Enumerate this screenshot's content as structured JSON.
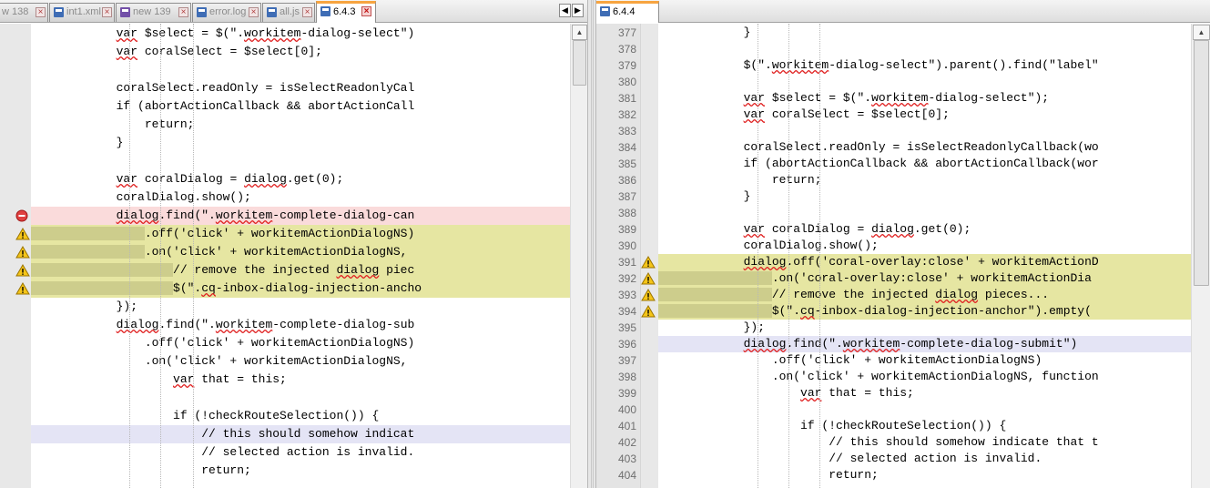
{
  "left": {
    "tabs": [
      {
        "label": "w 138",
        "icon": "blue"
      },
      {
        "label": "int1.xml",
        "icon": "blue"
      },
      {
        "label": "new 139",
        "icon": "purple"
      },
      {
        "label": "error.log",
        "icon": "blue"
      },
      {
        "label": "all.js",
        "icon": "blue"
      },
      {
        "label": "6.4.3",
        "icon": "blue"
      }
    ],
    "active_tab": "6.4.3",
    "lines": [
      {
        "text": "            var $select = $(\".workitem-dialog-select\")",
        "state": "normal"
      },
      {
        "text": "            var coralSelect = $select[0];",
        "state": "normal"
      },
      {
        "text": "",
        "state": "normal"
      },
      {
        "text": "            coralSelect.readOnly = isSelectReadonlyCal",
        "state": "normal"
      },
      {
        "text": "            if (abortActionCallback && abortActionCall",
        "state": "normal"
      },
      {
        "text": "                return;",
        "state": "normal"
      },
      {
        "text": "            }",
        "state": "normal"
      },
      {
        "text": "",
        "state": "normal"
      },
      {
        "text": "            var coralDialog = dialog.get(0);",
        "state": "normal"
      },
      {
        "text": "            coralDialog.show();",
        "state": "normal"
      },
      {
        "text": "            dialog.find(\".workitem-complete-dialog-can",
        "state": "removed"
      },
      {
        "text": "                .off('click' + workitemActionDialogNS)",
        "state": "changed"
      },
      {
        "text": "                .on('click' + workitemActionDialogNS,",
        "state": "changed"
      },
      {
        "text": "                    // remove the injected dialog piec",
        "state": "changed"
      },
      {
        "text": "                    $(\".cq-inbox-dialog-injection-ancho",
        "state": "changed"
      },
      {
        "text": "            });",
        "state": "normal"
      },
      {
        "text": "            dialog.find(\".workitem-complete-dialog-sub",
        "state": "normal"
      },
      {
        "text": "                .off('click' + workitemActionDialogNS)",
        "state": "normal"
      },
      {
        "text": "                .on('click' + workitemActionDialogNS,",
        "state": "normal"
      },
      {
        "text": "                    var that = this;",
        "state": "normal"
      },
      {
        "text": "",
        "state": "normal"
      },
      {
        "text": "                    if (!checkRouteSelection()) {",
        "state": "normal"
      },
      {
        "text": "                        // this should somehow indicat",
        "state": "moved"
      },
      {
        "text": "                        // selected action is invalid.",
        "state": "normal"
      },
      {
        "text": "                        return;",
        "state": "normal"
      }
    ]
  },
  "right": {
    "tabs": [
      {
        "label": "6.4.4",
        "icon": "blue"
      }
    ],
    "active_tab": "6.4.4",
    "lines": [
      {
        "num": "377",
        "text": "            }",
        "state": "normal"
      },
      {
        "num": "378",
        "text": "",
        "state": "normal"
      },
      {
        "num": "379",
        "text": "            $(\".workitem-dialog-select\").parent().find(\"label\"",
        "state": "normal"
      },
      {
        "num": "380",
        "text": "",
        "state": "normal"
      },
      {
        "num": "381",
        "text": "            var $select = $(\".workitem-dialog-select\");",
        "state": "normal"
      },
      {
        "num": "382",
        "text": "            var coralSelect = $select[0];",
        "state": "normal"
      },
      {
        "num": "383",
        "text": "",
        "state": "normal"
      },
      {
        "num": "384",
        "text": "            coralSelect.readOnly = isSelectReadonlyCallback(wo",
        "state": "normal"
      },
      {
        "num": "385",
        "text": "            if (abortActionCallback && abortActionCallback(wor",
        "state": "normal"
      },
      {
        "num": "386",
        "text": "                return;",
        "state": "normal"
      },
      {
        "num": "387",
        "text": "            }",
        "state": "normal"
      },
      {
        "num": "388",
        "text": "",
        "state": "normal"
      },
      {
        "num": "389",
        "text": "            var coralDialog = dialog.get(0);",
        "state": "normal"
      },
      {
        "num": "390",
        "text": "            coralDialog.show();",
        "state": "normal"
      },
      {
        "num": "391",
        "text": "            dialog.off('coral-overlay:close' + workitemActionD",
        "state": "changed"
      },
      {
        "num": "392",
        "text": "                .on('coral-overlay:close' + workitemActionDia",
        "state": "changed"
      },
      {
        "num": "393",
        "text": "                // remove the injected dialog pieces...",
        "state": "changed"
      },
      {
        "num": "394",
        "text": "                $(\".cq-inbox-dialog-injection-anchor\").empty(",
        "state": "changed"
      },
      {
        "num": "395",
        "text": "            });",
        "state": "normal"
      },
      {
        "num": "396",
        "text": "            dialog.find(\".workitem-complete-dialog-submit\")",
        "state": "moved"
      },
      {
        "num": "397",
        "text": "                .off('click' + workitemActionDialogNS)",
        "state": "normal"
      },
      {
        "num": "398",
        "text": "                .on('click' + workitemActionDialogNS, function",
        "state": "normal"
      },
      {
        "num": "399",
        "text": "                    var that = this;",
        "state": "normal"
      },
      {
        "num": "400",
        "text": "",
        "state": "normal"
      },
      {
        "num": "401",
        "text": "                    if (!checkRouteSelection()) {",
        "state": "normal"
      },
      {
        "num": "402",
        "text": "                        // this should somehow indicate that t",
        "state": "normal"
      },
      {
        "num": "403",
        "text": "                        // selected action is invalid.",
        "state": "normal"
      },
      {
        "num": "404",
        "text": "                        return;",
        "state": "normal"
      }
    ]
  },
  "colors": {
    "removed": "#fadbdb",
    "changed": "#e6e6a2",
    "moved": "#e4e4f5",
    "active_tab_accent": "#f7a440"
  },
  "icons": {
    "warning": "warning-icon",
    "error": "error-icon",
    "file": "file-icon",
    "close": "close-icon"
  }
}
